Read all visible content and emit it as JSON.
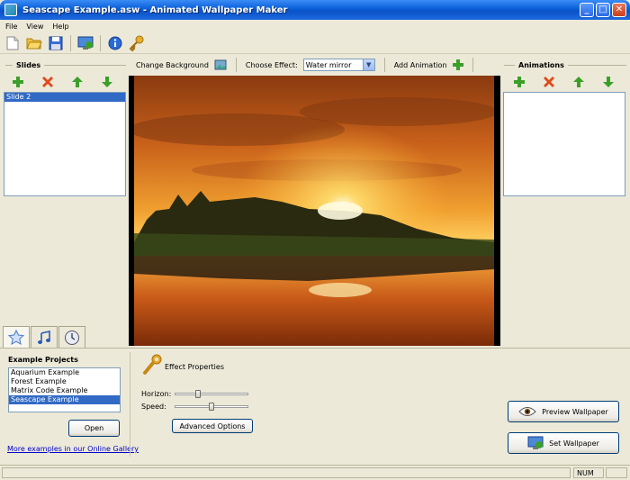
{
  "window": {
    "title": "Seascape Example.asw - Animated Wallpaper Maker"
  },
  "menu": [
    "File",
    "View",
    "Help"
  ],
  "toolbar": {
    "icons": [
      "new-file-icon",
      "open-folder-icon",
      "save-icon",
      "set-wallpaper-icon",
      "info-icon",
      "settings-key-icon"
    ]
  },
  "effects": {
    "change_background_label": "Change Background",
    "choose_effect_label": "Choose Effect:",
    "selected_effect": "Water mirror",
    "add_animation_label": "Add Animation"
  },
  "slides": {
    "title": "Slides",
    "items": [
      {
        "label": "Slide 2",
        "selected": true
      }
    ]
  },
  "animations": {
    "title": "Animations",
    "items": []
  },
  "examples": {
    "title": "Example Projects",
    "items": [
      {
        "label": "Aquarium Example",
        "selected": false
      },
      {
        "label": "Forest Example",
        "selected": false
      },
      {
        "label": "Matrix Code Example",
        "selected": false
      },
      {
        "label": "Seascape Example",
        "selected": true
      }
    ],
    "open_label": "Open",
    "gallery_link": "More examples in our Online Gallery"
  },
  "properties": {
    "title": "Effect Properties",
    "horizon_label": "Horizon:",
    "horizon_value": 0.3,
    "speed_label": "Speed:",
    "speed_value": 0.5,
    "advanced_label": "Advanced Options"
  },
  "actions": {
    "preview_label": "Preview Wallpaper",
    "set_label": "Set Wallpaper"
  },
  "status": {
    "num": "NUM"
  },
  "colors": {
    "titlebar": "#0a5fd8",
    "selection": "#316ac5",
    "add": "#3aa02a",
    "delete": "#e04a1a"
  }
}
